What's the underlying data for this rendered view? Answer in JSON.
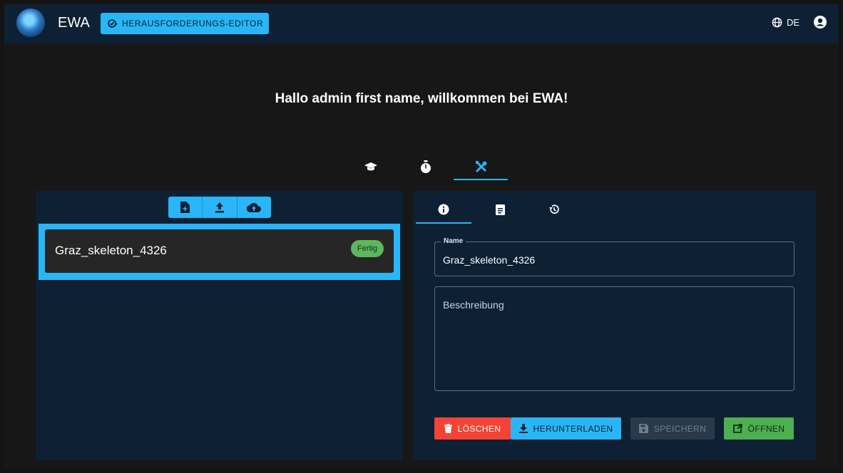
{
  "header": {
    "brand": "EWA",
    "mode_button_label": "HERAUSFORDERUNGS-EDITOR",
    "language": "DE"
  },
  "welcome_message": "Hallo admin first name, willkommen bei EWA!",
  "main_tabs": [
    {
      "icon": "graduation-cap-icon"
    },
    {
      "icon": "stopwatch-icon"
    },
    {
      "icon": "tools-icon",
      "active": true
    }
  ],
  "challenge_list": {
    "toolbar": [
      "new-file-icon",
      "upload-icon",
      "cloud-upload-icon"
    ],
    "items": [
      {
        "name": "Graz_skeleton_4326",
        "status": "Fertig",
        "selected": true
      }
    ]
  },
  "details": {
    "tabs": [
      {
        "icon": "info-icon",
        "active": true
      },
      {
        "icon": "document-icon"
      },
      {
        "icon": "history-icon"
      }
    ],
    "name_label": "Name",
    "name_value": "Graz_skeleton_4326",
    "description_placeholder": "Beschreibung",
    "buttons": {
      "delete": "LÖSCHEN",
      "download": "HERUNTERLADEN",
      "save": "SPEICHERN",
      "open": "ÖFFNEN"
    }
  },
  "colors": {
    "header_bg": "#0d2034",
    "accent": "#29b6f6",
    "danger": "#f44336",
    "success": "#4caf50",
    "page_bg": "#171717"
  }
}
